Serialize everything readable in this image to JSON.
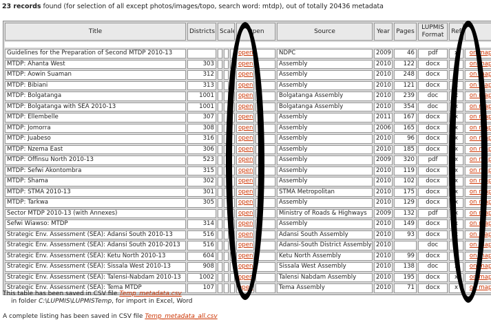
{
  "summary": {
    "count": "23 records",
    "rest": " found (for selection of all except photos/images/topo, search word: mtdp), out of totally 20436 metadata"
  },
  "columns": {
    "title": "Title",
    "districts": "Districts",
    "scale": "Scale",
    "open": "Open",
    "source": "Source",
    "year": "Year",
    "pages": "Pages",
    "format": "LUPMIS Format",
    "ref": "Ref"
  },
  "link_open": "open",
  "link_map": "on map",
  "rows": [
    {
      "title": "Guidelines for the Preparation of Second MTDP 2010-13",
      "district": "",
      "source": "NDPC",
      "year": "2009",
      "pages": "46",
      "format": "pdf",
      "ref": "x"
    },
    {
      "title": "MTDP: Ahanta West",
      "district": "303",
      "source": "Assembly",
      "year": "2010",
      "pages": "122",
      "format": "docx",
      "ref": "x"
    },
    {
      "title": "MTDP: Aowin Suaman",
      "district": "312",
      "source": "Assembly",
      "year": "2010",
      "pages": "248",
      "format": "docx",
      "ref": "x"
    },
    {
      "title": "MTDP: Bibiani",
      "district": "313",
      "source": "Assembly",
      "year": "2010",
      "pages": "121",
      "format": "docx",
      "ref": "x"
    },
    {
      "title": "MTDP: Bolgatanga",
      "district": "1001",
      "source": "Bolgatanga Assembly",
      "year": "2010",
      "pages": "239",
      "format": "doc",
      "ref": "x"
    },
    {
      "title": "MTDP: Bolgatanga with SEA 2010-13",
      "district": "1001",
      "source": "Bolgatanga Assembly",
      "year": "2010",
      "pages": "354",
      "format": "doc",
      "ref": "x"
    },
    {
      "title": "MTDP: Ellembelle",
      "district": "307",
      "source": "Assembly",
      "year": "2011",
      "pages": "167",
      "format": "docx",
      "ref": "x"
    },
    {
      "title": "MTDP: Jomorra",
      "district": "308",
      "source": "Assembly",
      "year": "2006",
      "pages": "165",
      "format": "docx",
      "ref": "x"
    },
    {
      "title": "MTDP: Juabeso",
      "district": "316",
      "source": "Assembly",
      "year": "2010",
      "pages": "96",
      "format": "docx",
      "ref": "x"
    },
    {
      "title": "MTDP: Nzema East",
      "district": "306",
      "source": "Assembly",
      "year": "2010",
      "pages": "185",
      "format": "docx",
      "ref": "x"
    },
    {
      "title": "MTDP: Offinsu North 2010-13",
      "district": "523",
      "source": "Assembly",
      "year": "2009",
      "pages": "320",
      "format": "pdf",
      "ref": "x"
    },
    {
      "title": "MTDP: Sefwi Akontombra",
      "district": "315",
      "source": "Assembly",
      "year": "2010",
      "pages": "119",
      "format": "docx",
      "ref": "x"
    },
    {
      "title": "MTDP: Shama",
      "district": "302",
      "source": "Assembly",
      "year": "2010",
      "pages": "102",
      "format": "docx",
      "ref": "x"
    },
    {
      "title": "MTDP: STMA 2010-13",
      "district": "301",
      "source": "STMA Metropolitan",
      "year": "2010",
      "pages": "175",
      "format": "docx",
      "ref": "x"
    },
    {
      "title": "MTDP: Tarkwa",
      "district": "305",
      "source": "Assembly",
      "year": "2010",
      "pages": "129",
      "format": "docx",
      "ref": "x"
    },
    {
      "title": "Sector MTDP 2010-13 (with Annexes)",
      "district": "",
      "source": "Ministry of Roads & Highways",
      "year": "2009",
      "pages": "132",
      "format": "pdf",
      "ref": "x"
    },
    {
      "title": "Sefwi Wiawso: MTDP",
      "district": "314",
      "source": "Assembly",
      "year": "2010",
      "pages": "149",
      "format": "docx",
      "ref": "x"
    },
    {
      "title": "Strategic Env. Assessment (SEA): Adansi South 2010-13",
      "district": "516",
      "source": "Adansi South Assembly",
      "year": "2010",
      "pages": "93",
      "format": "docx",
      "ref": "x"
    },
    {
      "title": "Strategic Env. Assessment (SEA): Adansi South 2010-2013",
      "district": "516",
      "source": "Adansi-South District Assembly",
      "year": "2010",
      "pages": "",
      "format": "doc",
      "ref": "x"
    },
    {
      "title": "Strategic Env. Assessment (SEA): Ketu North 2010-13",
      "district": "604",
      "source": "Ketu North Assembly",
      "year": "2010",
      "pages": "99",
      "format": "docx",
      "ref": "x"
    },
    {
      "title": "Strategic Env. Assessment (SEA): Sissala West 2010-13",
      "district": "908",
      "source": "Sissala West Assembly",
      "year": "2010",
      "pages": "138",
      "format": "doc",
      "ref": "x"
    },
    {
      "title": "Strategic Env. Assessment (SEA): Talensi-Nabdam 2010-13",
      "district": "1002",
      "source": "Talensi Nabdam Assembly",
      "year": "2010",
      "pages": "195",
      "format": "docx",
      "ref": "x"
    },
    {
      "title": "Strategic Env. Assessment (SEA): Tema MTDP",
      "district": "107",
      "source": "Tema Assembly",
      "year": "2010",
      "pages": "71",
      "format": "docx",
      "ref": "x"
    }
  ],
  "footer": {
    "line1_prefix": "This table has been saved in CSV file ",
    "line1_file": "Temp_metadata.csv",
    "line2_prefix": "in folder ",
    "line2_path": "C:\\LUPMIS\\LUPMISTemp",
    "line2_suffix": ", for import in Excel, Word",
    "line3_prefix": "A complete listing has been saved in CSV file ",
    "line3_file": "Temp_metadata_all.csv"
  }
}
